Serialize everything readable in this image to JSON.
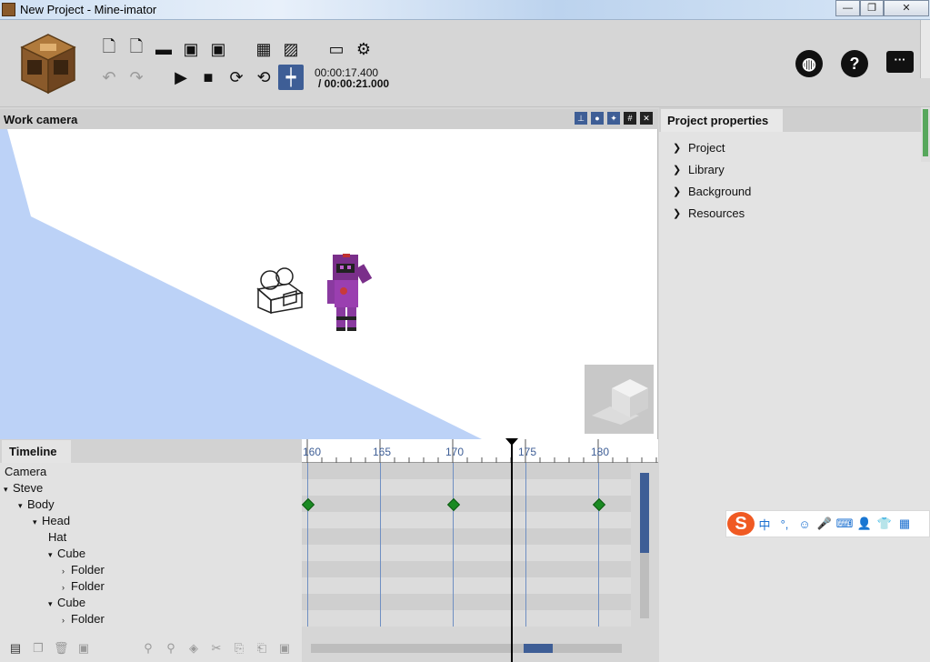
{
  "window": {
    "title": "New Project - Mine-imator",
    "minimize": "—",
    "restore": "❐",
    "close": "✕"
  },
  "toolbar": {
    "row1_icons": [
      "new-file-icon",
      "new-file-plus-icon",
      "open-folder-icon",
      "save-icon",
      "save-as-icon",
      "render-film-icon",
      "render-image-icon",
      "window-icon",
      "settings-gear-icon"
    ],
    "row2_icons": [
      "undo-icon",
      "redo-icon",
      "play-icon",
      "stop-icon",
      "loop-icon",
      "loop-region-icon",
      "timeline-marker-icon"
    ],
    "time_current": "00:00:17.400",
    "time_total": "/ 00:00:21.000",
    "right_icons": [
      "globe-icon",
      "help-icon",
      "feedback-icon"
    ]
  },
  "viewport": {
    "title": "Work camera",
    "header_buttons": [
      "axis-icon",
      "light-icon",
      "effects-icon",
      "grid-icon",
      "close-view-icon"
    ]
  },
  "properties": {
    "tab": "Project properties",
    "items": [
      "Project",
      "Library",
      "Background",
      "Resources"
    ]
  },
  "timeline": {
    "tab": "Timeline",
    "tree": [
      {
        "label": "Camera",
        "indent": 0,
        "arrow": ""
      },
      {
        "label": "Steve",
        "indent": 0,
        "arrow": "▾"
      },
      {
        "label": "Body",
        "indent": 1,
        "arrow": "▾"
      },
      {
        "label": "Head",
        "indent": 2,
        "arrow": "▾"
      },
      {
        "label": "Hat",
        "indent": 3,
        "arrow": ""
      },
      {
        "label": "Cube",
        "indent": 3,
        "arrow": "▾"
      },
      {
        "label": "Folder",
        "indent": 4,
        "arrow": "›"
      },
      {
        "label": "Folder",
        "indent": 4,
        "arrow": "›"
      },
      {
        "label": "Cube",
        "indent": 3,
        "arrow": "▾"
      },
      {
        "label": "Folder",
        "indent": 4,
        "arrow": "›"
      }
    ],
    "ruler_labels": [
      "160",
      "165",
      "170",
      "175",
      "180"
    ],
    "keyframe_frames": [
      160,
      170,
      180
    ],
    "playhead_frame": 174,
    "footer_icons": [
      "add-folder-icon",
      "duplicate-icon",
      "delete-icon",
      "save-object-icon",
      "walk-icon",
      "run-icon",
      "add-keyframe-icon",
      "cut-icon",
      "copy-icon",
      "paste-icon",
      "save-keyframes-icon"
    ]
  },
  "ime": {
    "logo": "S",
    "items": [
      "中",
      "°,",
      "☺",
      "🎤",
      "⌨",
      "👤",
      "👕",
      "▦"
    ]
  }
}
